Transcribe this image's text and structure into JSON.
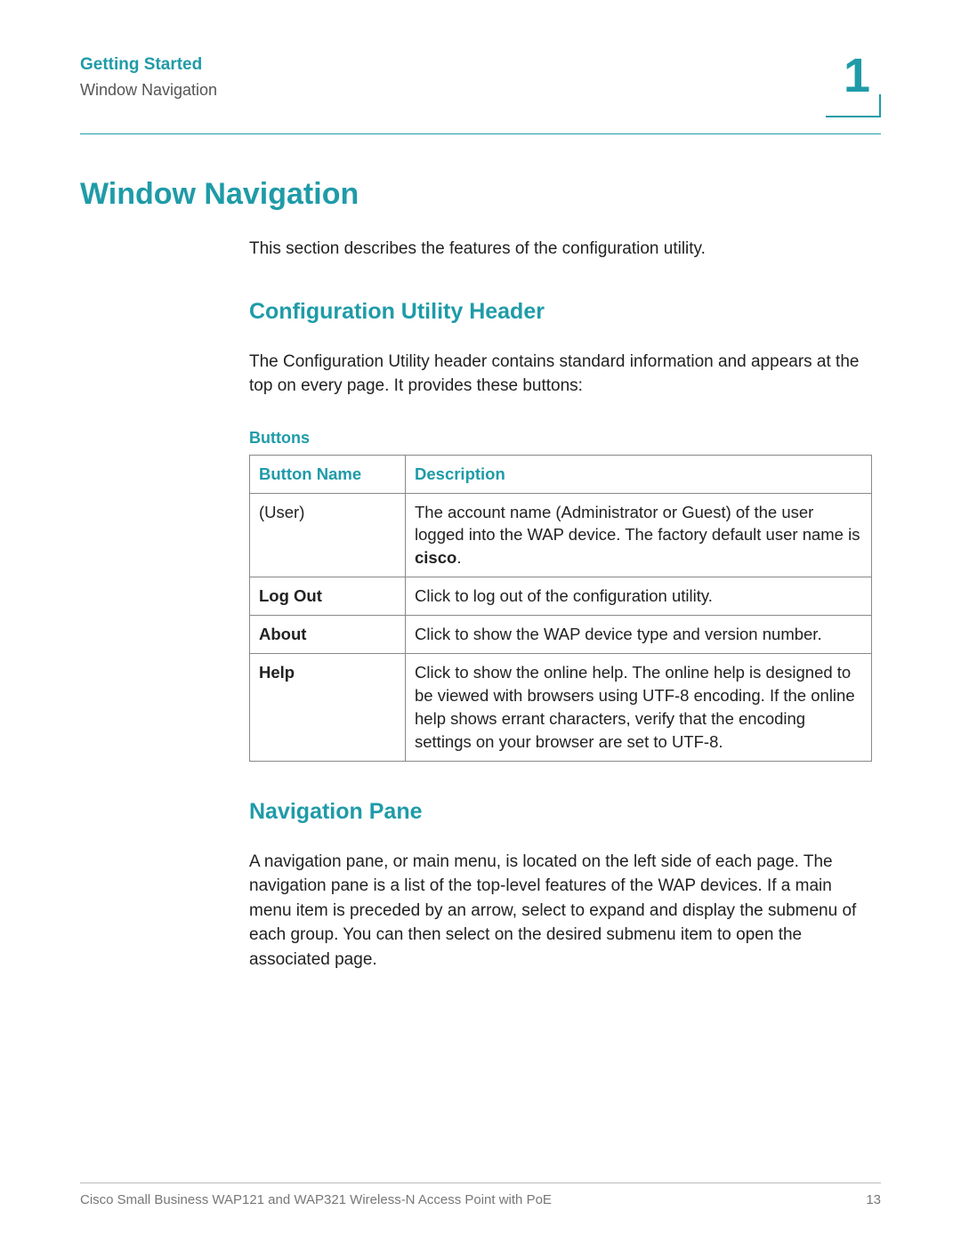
{
  "header": {
    "chapter_title": "Getting Started",
    "section_title": "Window Navigation",
    "chapter_number": "1"
  },
  "h1": "Window Navigation",
  "intro": "This section describes the features of the configuration utility.",
  "sec1": {
    "heading": "Configuration Utility Header",
    "para": "The Configuration Utility header contains standard information and appears at the top on every page. It provides these buttons:",
    "table_caption": "Buttons",
    "columns": {
      "name": "Button Name",
      "desc": "Description"
    },
    "rows": [
      {
        "name": "(User)",
        "name_bold": false,
        "desc_pre": "The account name (Administrator or Guest) of the user logged into the WAP device. The factory default user name is ",
        "desc_bold": "cisco",
        "desc_post": "."
      },
      {
        "name": "Log Out",
        "name_bold": true,
        "desc_pre": "Click to log out of the configuration utility.",
        "desc_bold": "",
        "desc_post": ""
      },
      {
        "name": "About",
        "name_bold": true,
        "desc_pre": "Click to show the WAP device type and version number.",
        "desc_bold": "",
        "desc_post": ""
      },
      {
        "name": "Help",
        "name_bold": true,
        "desc_pre": "Click to show the online help. The online help is designed to be viewed with browsers using UTF-8 encoding. If the online help shows errant characters, verify that the encoding settings on your browser are set to UTF-8.",
        "desc_bold": "",
        "desc_post": ""
      }
    ]
  },
  "sec2": {
    "heading": "Navigation Pane",
    "para": "A navigation pane, or main menu, is located on the left side of each page. The navigation pane is a list of the top-level features of the WAP devices. If a main menu item is preceded by an arrow, select to expand and display the submenu of each group. You can then select on the desired submenu item to open the associated page."
  },
  "footer": {
    "doc_title": "Cisco Small Business WAP121 and WAP321 Wireless-N Access Point with PoE",
    "page_number": "13"
  }
}
